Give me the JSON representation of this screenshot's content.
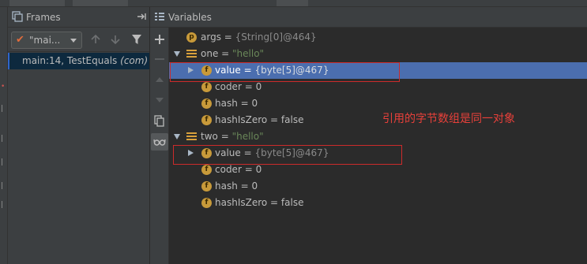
{
  "frames_panel": {
    "title": "Frames",
    "thread_selector": {
      "value": "\"mai..."
    },
    "frames": [
      {
        "method": "main:14, TestEquals",
        "class": "(com)"
      }
    ]
  },
  "variables_panel": {
    "title": "Variables",
    "tree": [
      {
        "name": "args",
        "eq": " = ",
        "value": "{String[0]@464}",
        "icon": "p"
      },
      {
        "name": "one",
        "eq": " = ",
        "value": "\"hello\""
      },
      {
        "name": "value",
        "eq": " = ",
        "value": "{byte[5]@467}",
        "icon": "f"
      },
      {
        "name": "coder",
        "eq": " = ",
        "value": "0",
        "icon": "f"
      },
      {
        "name": "hash",
        "eq": " = ",
        "value": "0",
        "icon": "f"
      },
      {
        "name": "hashIsZero",
        "eq": " = ",
        "value": "false",
        "icon": "f"
      },
      {
        "name": "two",
        "eq": " = ",
        "value": "\"hello\""
      },
      {
        "name": "value",
        "eq": " = ",
        "value": "{byte[5]@467}",
        "icon": "f"
      },
      {
        "name": "coder",
        "eq": " = ",
        "value": "0",
        "icon": "f"
      },
      {
        "name": "hash",
        "eq": " = ",
        "value": "0",
        "icon": "f"
      },
      {
        "name": "hashIsZero",
        "eq": " = ",
        "value": "false",
        "icon": "f"
      }
    ]
  },
  "annotation": {
    "text": "引用的字节数组是同一对象"
  },
  "colors": {
    "annotation": "#e8403a",
    "selection": "#4b6eaf",
    "field_icon": "#c89a3a",
    "string_value": "#6a8759"
  },
  "icons": [
    "frames-icon",
    "pin-icon",
    "up-arrow-icon",
    "down-arrow-icon",
    "filter-icon",
    "add-icon",
    "remove-icon",
    "copy-icon",
    "glasses-icon"
  ]
}
